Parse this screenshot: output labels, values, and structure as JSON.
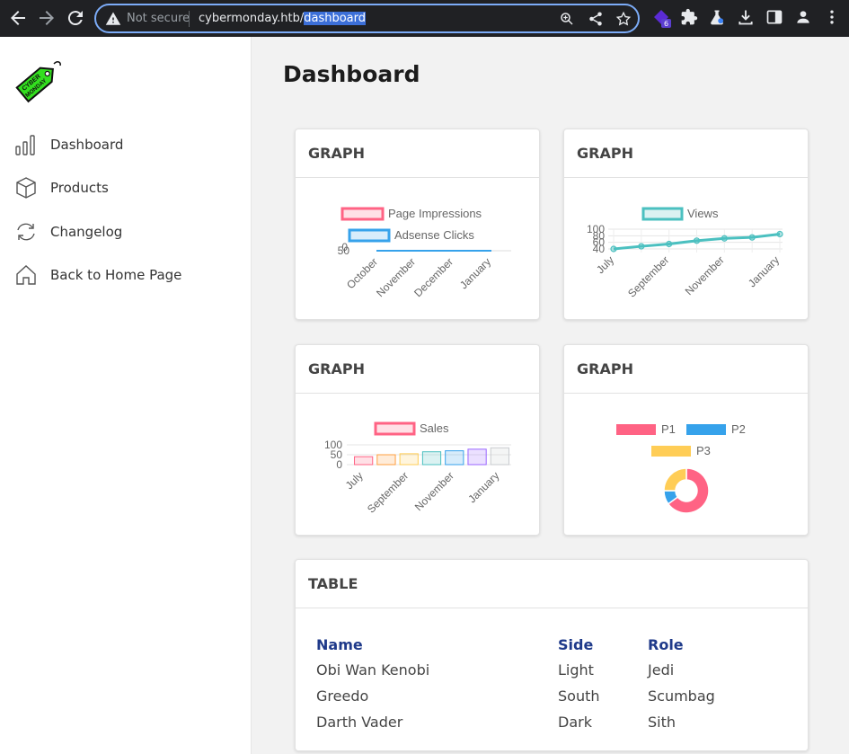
{
  "browser": {
    "security_label": "Not secure",
    "url_host": "cybermonday.htb/",
    "url_path": "dashboard",
    "extension_badge": "6"
  },
  "sidebar": {
    "logo_text": "CYBER MONDAY",
    "items": [
      {
        "label": "Dashboard",
        "icon": "bar-chart-icon"
      },
      {
        "label": "Products",
        "icon": "box-icon"
      },
      {
        "label": "Changelog",
        "icon": "refresh-icon"
      },
      {
        "label": "Back to Home Page",
        "icon": "home-icon"
      }
    ]
  },
  "main": {
    "title": "Dashboard",
    "cards": [
      {
        "header": "GRAPH"
      },
      {
        "header": "GRAPH"
      },
      {
        "header": "GRAPH"
      },
      {
        "header": "GRAPH"
      },
      {
        "header": "TABLE"
      }
    ],
    "table": {
      "headers": [
        "Name",
        "Side",
        "Role"
      ],
      "rows": [
        [
          "Obi Wan Kenobi",
          "Light",
          "Jedi"
        ],
        [
          "Greedo",
          "South",
          "Scumbag"
        ],
        [
          "Darth Vader",
          "Dark",
          "Sith"
        ]
      ]
    }
  },
  "chart_data": [
    {
      "type": "line",
      "categories": [
        "October",
        "November",
        "December",
        "January"
      ],
      "series": [
        {
          "name": "Page Impressions",
          "color": "#ff6384",
          "values": [
            0,
            0,
            0,
            0
          ]
        },
        {
          "name": "Adsense Clicks",
          "color": "#36a2eb",
          "values": [
            0,
            0,
            0,
            0
          ]
        }
      ],
      "ytick_labels": [
        "50",
        "0"
      ],
      "legend": "top"
    },
    {
      "type": "line",
      "categories": [
        "July",
        "September",
        "November",
        "January"
      ],
      "x_points": 7,
      "series": [
        {
          "name": "Views",
          "color": "#4bc0c0",
          "values": [
            40,
            48,
            55,
            65,
            72,
            75,
            85
          ]
        }
      ],
      "ytick_labels": [
        "100",
        "80",
        "60",
        "40"
      ],
      "ylim": [
        40,
        100
      ],
      "grid": true,
      "legend": "top"
    },
    {
      "type": "bar",
      "categories": [
        "July",
        "September",
        "November",
        "January"
      ],
      "x_points": 7,
      "series": [
        {
          "name": "Sales",
          "values": [
            40,
            50,
            55,
            65,
            70,
            78,
            85
          ]
        }
      ],
      "bar_colors": [
        "#ff6384",
        "#ff9f40",
        "#ffcd56",
        "#4bc0c0",
        "#36a2eb",
        "#9966ff",
        "#c9cbcf"
      ],
      "ytick_labels": [
        "100",
        "50",
        "0"
      ],
      "ylim": [
        0,
        100
      ],
      "legend": "top"
    },
    {
      "type": "pie",
      "categories": [
        "P1",
        "P2",
        "P3"
      ],
      "values": [
        65,
        10,
        25
      ],
      "colors": [
        "#ff6384",
        "#36a2eb",
        "#ffcd56"
      ],
      "doughnut": true,
      "legend": "top"
    }
  ]
}
